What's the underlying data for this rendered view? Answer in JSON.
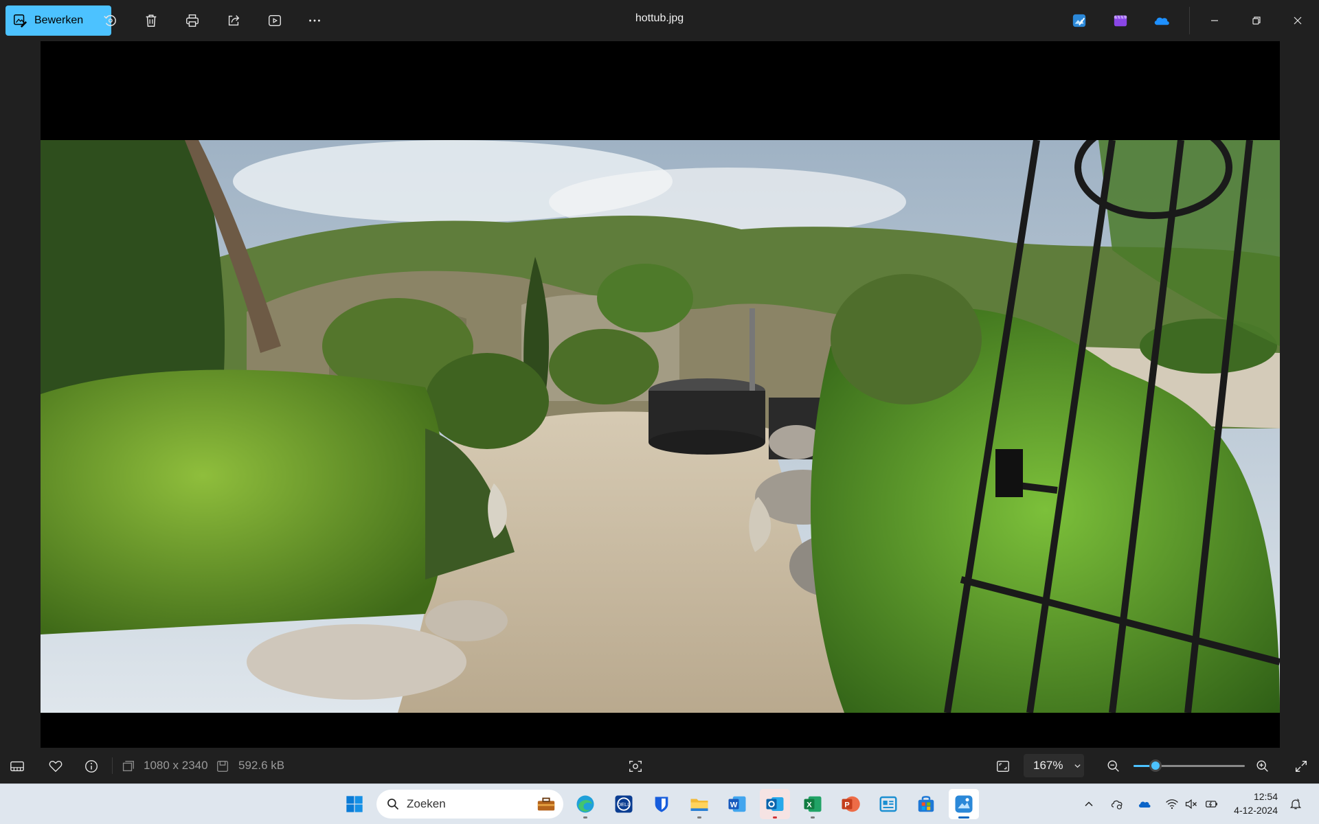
{
  "toolbar": {
    "edit_label": "Bewerken",
    "actions": [
      "rotate-icon",
      "delete-icon",
      "print-icon",
      "share-icon",
      "slideshow-icon",
      "more-icon"
    ]
  },
  "window": {
    "title": "hottub.jpg"
  },
  "statusbar": {
    "dimensions": "1080 x 2340",
    "file_size": "592.6 kB",
    "zoom_label": "167%",
    "zoom_level_percent": 167,
    "zoom_slider_fraction": 0.2
  },
  "taskbar": {
    "search_placeholder": "Zoeken",
    "apps": [
      "work-bag",
      "edge",
      "dell",
      "bitwarden",
      "file-explorer",
      "word",
      "outlook",
      "excel",
      "powerpoint",
      "news",
      "store",
      "photos"
    ],
    "time": "12:54",
    "date": "4-12-2024"
  },
  "colors": {
    "accent": "#4cc2ff",
    "chrome_bg": "#202020",
    "taskbar_bg": "#dfe6ee"
  }
}
